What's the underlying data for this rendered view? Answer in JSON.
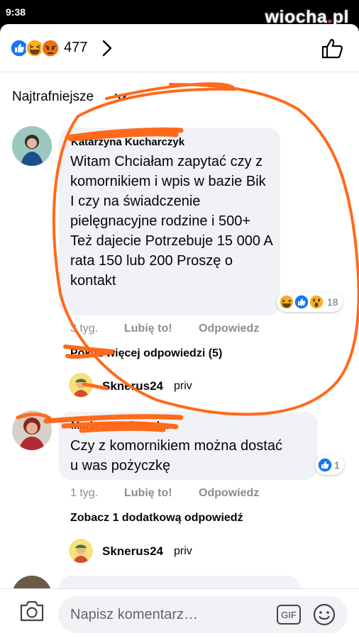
{
  "status": {
    "time": "9:38"
  },
  "watermark": {
    "name": "wiocha",
    "tld": "pl",
    "dot": "."
  },
  "header": {
    "reaction_count": "477",
    "reaction_icons": [
      "like-icon",
      "haha-icon",
      "angry-icon"
    ]
  },
  "sort": {
    "label": "Najtrafniejsze"
  },
  "comments": [
    {
      "author": "Katarzyna Kucharczyk",
      "text": "Witam Chciałam zapytać czy z komornikiem i wpis w bazie Bik I czy na świadczenie pielęgnacyjne rodzine i 500+ Też dajecie Potrzebuje 15 000 A rata 150 lub 200 Proszę o kontakt",
      "time": "3 tyg.",
      "like_label": "Lubię to!",
      "reply_label": "Odpowiedz",
      "reactions": [
        "haha-icon",
        "like-icon",
        "wow-icon"
      ],
      "reaction_count": "18",
      "more_replies": "Pokaż więcej odpowiedzi (5)",
      "reply_author": "Sknerus24",
      "reply_extra": "priv"
    },
    {
      "author": "Maria Nowakowska",
      "text": "Czy z komornikiem można dostać u was pożyczkę",
      "time": "1 tyg.",
      "like_label": "Lubię to!",
      "reply_label": "Odpowiedz",
      "reactions": [
        "like-icon"
      ],
      "reaction_count": "1",
      "more_replies": "Zobacz 1 dodatkową odpowiedź",
      "reply_author": "Sknerus24",
      "reply_extra": "priv"
    }
  ],
  "composer": {
    "placeholder": "Napisz komentarz…",
    "gif_label": "GIF"
  },
  "colors": {
    "like_blue": "#1877f2",
    "annotation_orange": "#ff6a1a",
    "text": "#050505",
    "meta": "#8a8d91"
  }
}
